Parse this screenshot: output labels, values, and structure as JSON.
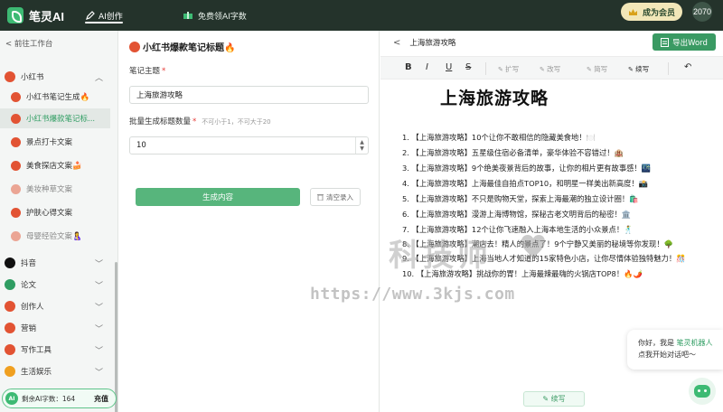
{
  "header": {
    "logo_text": "笔灵AI",
    "nav_ai": "AI创作",
    "nav_free": "免费领AI字数",
    "vip_label": "成为会员",
    "avatar_text": "2070"
  },
  "sidebar": {
    "back_label": "< 前往工作台",
    "group_xhs": "小红书",
    "items": [
      {
        "label": "小红书笔记生成🔥"
      },
      {
        "label": "小红书爆款笔记标..."
      },
      {
        "label": "景点打卡文案"
      },
      {
        "label": "美食探店文案🍰"
      },
      {
        "label": "美妆种草文案"
      },
      {
        "label": "护肤心得文案"
      },
      {
        "label": "母婴经验文案🤱"
      }
    ],
    "groups": [
      {
        "label": "抖音"
      },
      {
        "label": "论文"
      },
      {
        "label": "创作人"
      },
      {
        "label": "营销"
      },
      {
        "label": "写作工具"
      },
      {
        "label": "生活娱乐"
      }
    ],
    "remaining": "剩余AI字数：164",
    "charge": "充值",
    "ai_badge": "AI"
  },
  "form": {
    "title": "小红书爆款笔记标题🔥",
    "topic_label": "笔记主题",
    "topic_value": "上海旅游攻略",
    "count_label": "批量生成标题数量",
    "count_hint": "不可小于1，不可大于20",
    "count_value": "10",
    "generate_label": "生成内容",
    "clear_label": "清空录入",
    "required_mark": "*"
  },
  "editor": {
    "back": "<",
    "doc_name": "上海旅游攻略",
    "export_label": "导出Word",
    "toolbar": {
      "bold": "B",
      "italic": "I",
      "underline": "U",
      "strike": "S",
      "expand": "扩写",
      "rewrite": "改写",
      "simplify": "简写",
      "continue": "续写",
      "undo": "↶"
    },
    "heading": "上海旅游攻略",
    "lines": [
      "1. 【上海旅游攻略】10个让你不敢相信的隐藏美食地！🍽️",
      "2. 【上海旅游攻略】五星级住宿必备清单，豪华体验不容错过！🏨",
      "3. 【上海旅游攻略】9个绝美夜景背后的故事，让你的相片更有故事感！🌃",
      "4. 【上海旅游攻略】上海最佳自拍点TOP10，和明星一样美出新高度！📸",
      "5. 【上海旅游攻略】不只是购物天堂，探索上海最潮的独立设计圈！🛍️",
      "6. 【上海旅游攻略】漫游上海博物馆，探秘古老文明背后的秘密！🏛️",
      "7. 【上海旅游攻略】12个让你飞速融入上海本地生活的小众景点！🕺",
      "8. 【上海旅游攻略】潮店去！精人的景点了！9个宁静又美丽的秘境等你发现！🌳",
      "9. 【上海旅游攻略】上海当地人才知道的15家特色小店，让你尽情体验独特魅力！🎊",
      "10. 【上海旅游攻略】挑战你的胃！上海最辣最嗨的火锅店TOP8！🔥🌶️"
    ],
    "continue_btn": "续写",
    "watermark_text": "科技师",
    "watermark_url": "https://www.3kjs.com",
    "bot_line1_prefix": "你好，我是",
    "bot_brand": "笔灵机器人",
    "bot_line2": "点我开始对话吧～"
  },
  "colors": {
    "topbar": "#24332b",
    "accent": "#3dba73",
    "button_green": "#57b57c",
    "export_green": "#3a9a63",
    "vip_bg": "#f2e7b8"
  }
}
